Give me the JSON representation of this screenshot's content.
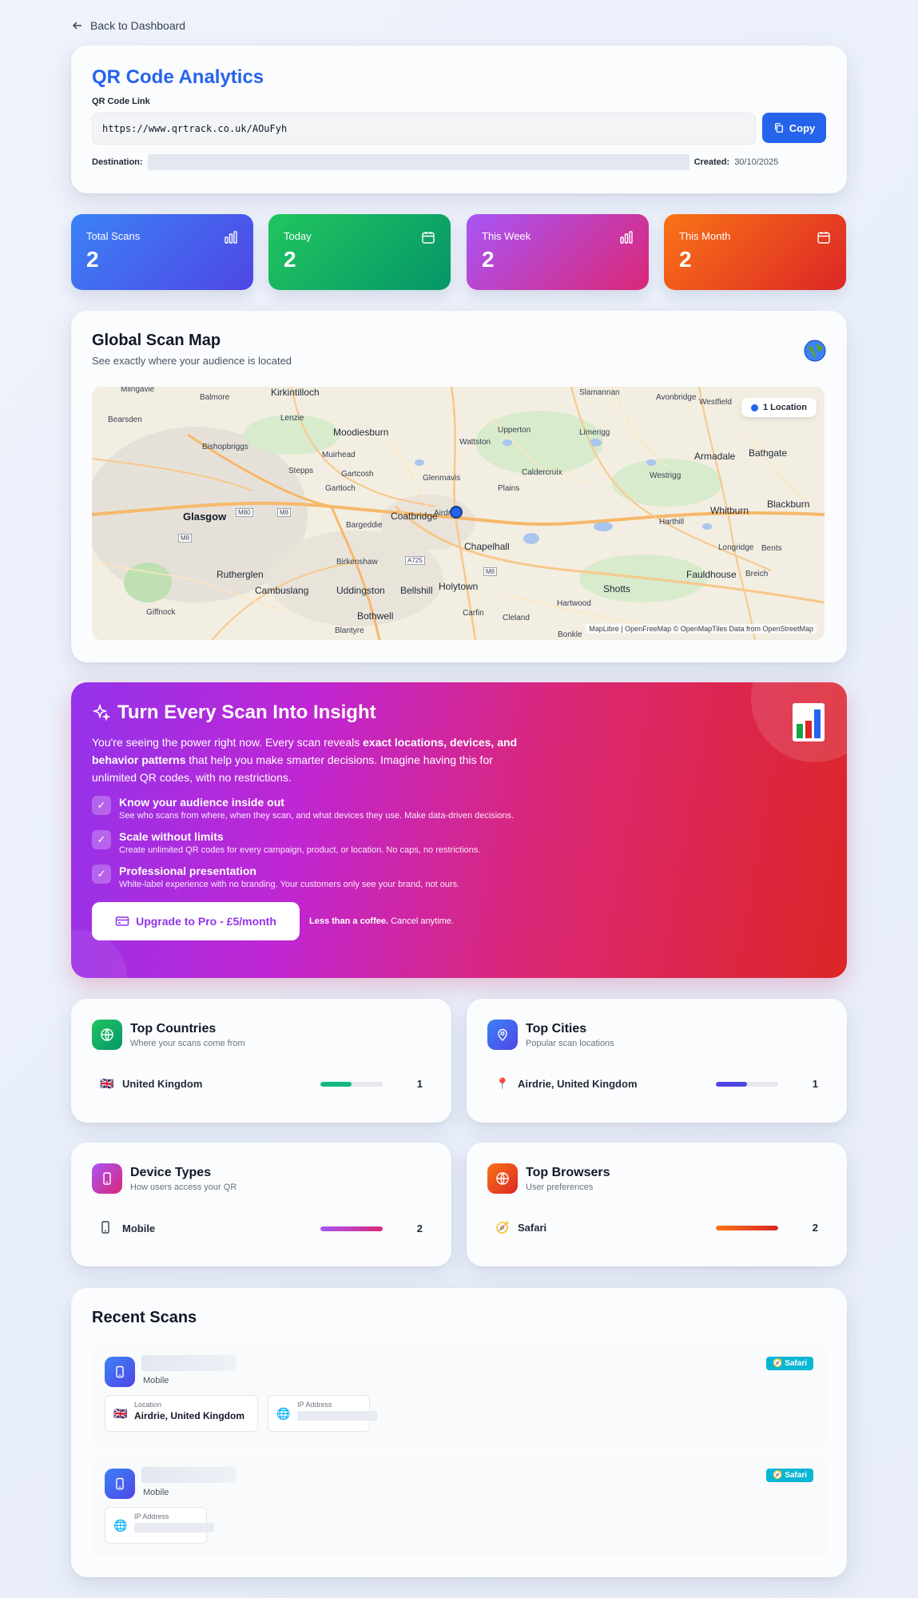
{
  "nav": {
    "back_label": "Back to Dashboard"
  },
  "header": {
    "title": "QR Code Analytics",
    "link_label": "QR Code Link",
    "link_value": "https://www.qrtrack.co.uk/AOuFyh",
    "copy_label": "Copy",
    "destination_label": "Destination:",
    "created_label": "Created:",
    "created_value": "30/10/2025"
  },
  "stats": [
    {
      "label": "Total Scans",
      "value": "2",
      "icon": "bar-chart-icon"
    },
    {
      "label": "Today",
      "value": "2",
      "icon": "calendar-icon"
    },
    {
      "label": "This Week",
      "value": "2",
      "icon": "bar-chart-icon"
    },
    {
      "label": "This Month",
      "value": "2",
      "icon": "calendar-icon"
    }
  ],
  "map": {
    "title": "Global Scan Map",
    "subtitle": "See exactly where your audience is located",
    "locations_badge": "1 Location",
    "attribution": "MapLibre | OpenFreeMap © OpenMapTiles Data from OpenStreetMap",
    "places": {
      "glasgow": "Glasgow",
      "coatbridge": "Coatbridge",
      "chapelhall": "Chapelhall",
      "airdrie": "Airdrie",
      "armadale": "Armadale",
      "bathgate": "Bathgate",
      "whitburn": "Whitburn",
      "blackburn": "Blackburn",
      "fauldhouse": "Fauldhouse",
      "shotts": "Shotts",
      "holytown": "Holytown",
      "bellshill": "Bellshill",
      "uddingston": "Uddingston",
      "cambuslang": "Cambuslang",
      "rutherglen": "Rutherglen",
      "bothwell": "Bothwell",
      "giffnock": "Giffnock",
      "blantyre": "Blantyre",
      "bearsden": "Bearsden",
      "bishopbriggs": "Bishopbriggs",
      "lenzie": "Lenzie",
      "moodiesburn": "Moodiesburn",
      "kirkintilloch": "Kirkintilloch",
      "stepps": "Stepps",
      "gartcosh": "Gartcosh",
      "muirhead": "Muirhead",
      "gartloch": "Gartloch",
      "bargeddie": "Bargeddie",
      "birkenshaw": "Birkenshaw",
      "glenmavis": "Glenmavis",
      "plains": "Plains",
      "caldercruix": "Caldercruix",
      "upperton": "Upperton",
      "limerigg": "Limerigg",
      "slamannan": "Slamannan",
      "avonbridge": "Avonbridge",
      "westfield": "Westfield",
      "westrigg": "Westrigg",
      "harthill": "Harthill",
      "longridge": "Longridge",
      "breich": "Breich",
      "hartwood": "Hartwood",
      "cleland": "Cleland",
      "carfin": "Carfin",
      "wattston": "Wattston",
      "balmore": "Balmore",
      "milngavie": "Milngavie",
      "bents": "Bents",
      "bonkle": "Bonkle"
    },
    "roads": [
      "M80",
      "M8",
      "A725",
      "M8",
      "M8"
    ]
  },
  "promo": {
    "title": "Turn Every Scan Into Insight",
    "desc_1": "You're seeing the power right now. Every scan reveals ",
    "desc_b1": "exact locations, devices, and behavior patterns",
    "desc_2": " that help you make smarter decisions. Imagine having this for unlimited QR codes, with no restrictions.",
    "features": [
      {
        "title": "Know your audience inside out",
        "desc": "See who scans from where, when they scan, and what devices they use. Make data-driven decisions."
      },
      {
        "title": "Scale without limits",
        "desc": "Create unlimited QR codes for every campaign, product, or location. No caps, no restrictions."
      },
      {
        "title": "Professional presentation",
        "desc": "White-label experience with no branding. Your customers only see your brand, not ours."
      }
    ],
    "cta_label": "Upgrade to Pro - £5/month",
    "note_bold": "Less than a coffee.",
    "note_rest": " Cancel anytime."
  },
  "countries": {
    "title": "Top Countries",
    "subtitle": "Where your scans come from",
    "items": [
      {
        "flag": "🇬🇧",
        "name": "United Kingdom",
        "count": "1",
        "share": 0.5
      }
    ]
  },
  "cities": {
    "title": "Top Cities",
    "subtitle": "Popular scan locations",
    "items": [
      {
        "flag": "📍",
        "name": "Airdrie, United Kingdom",
        "count": "1",
        "share": 0.5
      }
    ]
  },
  "devices": {
    "title": "Device Types",
    "subtitle": "How users access your QR",
    "items": [
      {
        "name": "Mobile",
        "count": "2",
        "share": 1.0
      }
    ]
  },
  "browsers": {
    "title": "Top Browsers",
    "subtitle": "User preferences",
    "items": [
      {
        "flag": "🧭",
        "name": "Safari",
        "count": "2",
        "share": 1.0
      }
    ]
  },
  "recent": {
    "title": "Recent Scans",
    "scans": [
      {
        "device": "Mobile",
        "browser": "Safari",
        "location_label": "Location",
        "location_flag": "🇬🇧",
        "location": "Airdrie, United Kingdom",
        "ip_label": "IP Address"
      },
      {
        "device": "Mobile",
        "browser": "Safari",
        "ip_label": "IP Address"
      }
    ]
  },
  "colors": {
    "accent": "#2563eb",
    "green": "#10b981",
    "purple": "#a855f7",
    "orange": "#f97316"
  }
}
